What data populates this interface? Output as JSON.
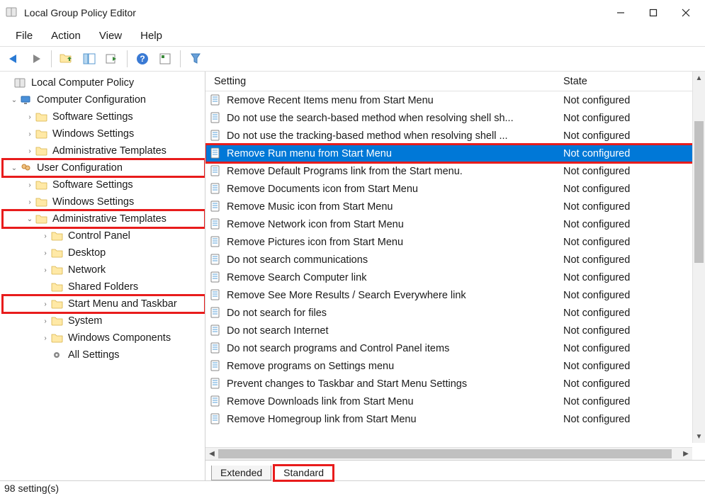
{
  "window_title": "Local Group Policy Editor",
  "menu": [
    "File",
    "Action",
    "View",
    "Help"
  ],
  "tree": {
    "root": "Local Computer Policy",
    "computer_cfg": "Computer Configuration",
    "cc_software": "Software Settings",
    "cc_windows": "Windows Settings",
    "cc_admin": "Administrative Templates",
    "user_cfg": "User Configuration",
    "uc_software": "Software Settings",
    "uc_windows": "Windows Settings",
    "uc_admin": "Administrative Templates",
    "uc_cp": "Control Panel",
    "uc_desktop": "Desktop",
    "uc_network": "Network",
    "uc_shared": "Shared Folders",
    "uc_start": "Start Menu and Taskbar",
    "uc_system": "System",
    "uc_wincomp": "Windows Components",
    "uc_allset": "All Settings"
  },
  "columns": {
    "setting": "Setting",
    "state": "State"
  },
  "settings": [
    {
      "name": "Remove Recent Items menu from Start Menu",
      "state": "Not configured"
    },
    {
      "name": "Do not use the search-based method when resolving shell sh...",
      "state": "Not configured"
    },
    {
      "name": "Do not use the tracking-based method when resolving shell ...",
      "state": "Not configured"
    },
    {
      "name": "Remove Run menu from Start Menu",
      "state": "Not configured",
      "selected": true
    },
    {
      "name": "Remove Default Programs link from the Start menu.",
      "state": "Not configured"
    },
    {
      "name": "Remove Documents icon from Start Menu",
      "state": "Not configured"
    },
    {
      "name": "Remove Music icon from Start Menu",
      "state": "Not configured"
    },
    {
      "name": "Remove Network icon from Start Menu",
      "state": "Not configured"
    },
    {
      "name": "Remove Pictures icon from Start Menu",
      "state": "Not configured"
    },
    {
      "name": "Do not search communications",
      "state": "Not configured"
    },
    {
      "name": "Remove Search Computer link",
      "state": "Not configured"
    },
    {
      "name": "Remove See More Results / Search Everywhere link",
      "state": "Not configured"
    },
    {
      "name": "Do not search for files",
      "state": "Not configured"
    },
    {
      "name": "Do not search Internet",
      "state": "Not configured"
    },
    {
      "name": "Do not search programs and Control Panel items",
      "state": "Not configured"
    },
    {
      "name": "Remove programs on Settings menu",
      "state": "Not configured"
    },
    {
      "name": "Prevent changes to Taskbar and Start Menu Settings",
      "state": "Not configured"
    },
    {
      "name": "Remove Downloads link from Start Menu",
      "state": "Not configured"
    },
    {
      "name": "Remove Homegroup link from Start Menu",
      "state": "Not configured"
    }
  ],
  "tabs": {
    "extended": "Extended",
    "standard": "Standard"
  },
  "status": "98 setting(s)"
}
